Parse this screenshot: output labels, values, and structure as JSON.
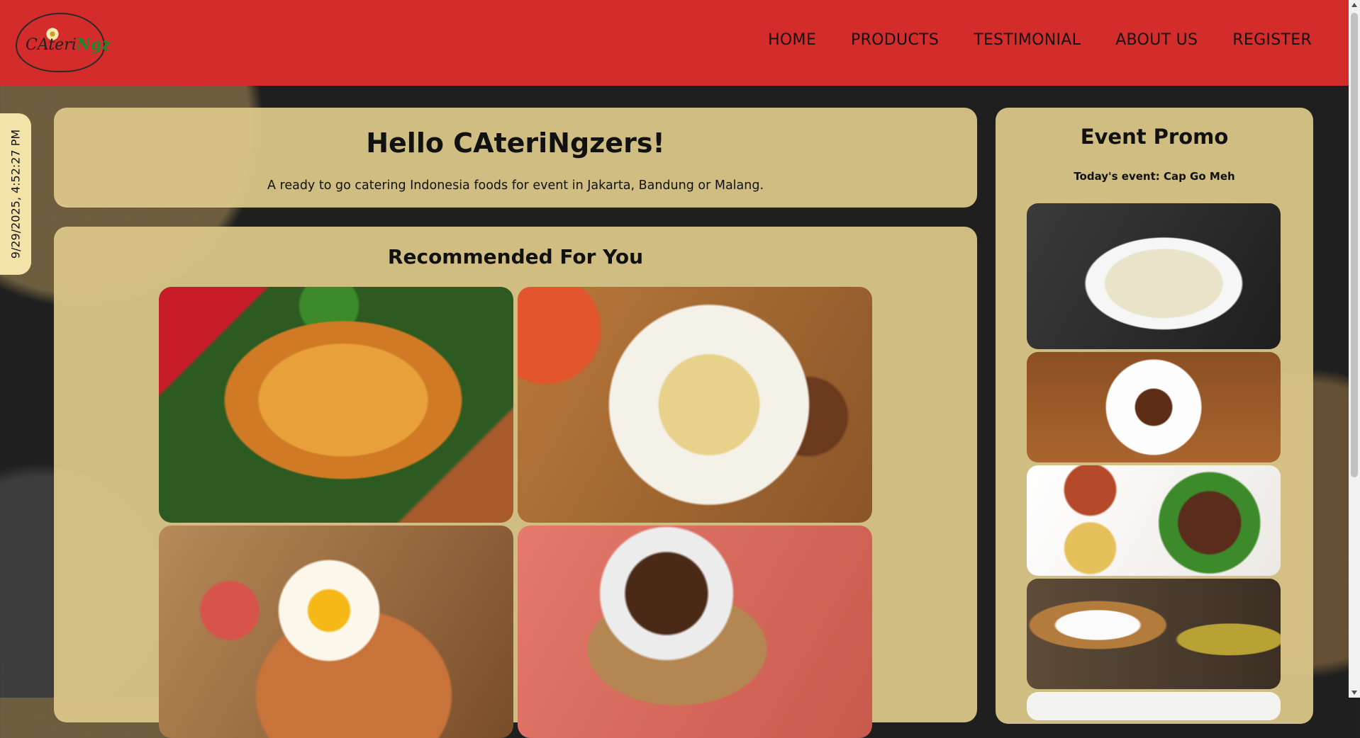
{
  "header": {
    "logo": {
      "text_prefix": "CAteri",
      "text_suffix": "Ngz"
    },
    "nav": [
      "HOME",
      "PRODUCTS",
      "TESTIMONIAL",
      "ABOUT US",
      "REGISTER"
    ]
  },
  "clock": {
    "datetime": "9/29/2025, 4:52:27 PM"
  },
  "hero": {
    "title": "Hello CAteriNgzers!",
    "subtitle": "A ready to go catering Indonesia foods for event in Jakarta, Bandung or Malang."
  },
  "recommended": {
    "title": "Recommended For You"
  },
  "promo": {
    "title": "Event Promo",
    "today": "Today's event: Cap Go Meh"
  },
  "colors": {
    "header_bg": "#d42b2b",
    "panel_bg": "#ddc98a",
    "page_bg": "#1f1f1f"
  }
}
